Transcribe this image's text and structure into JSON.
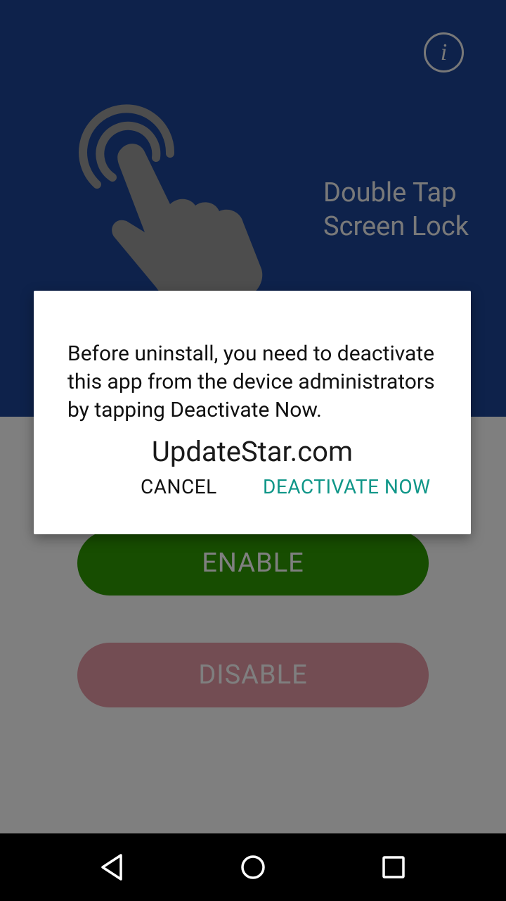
{
  "header": {
    "app_title_line1": "Double Tap",
    "app_title_line2": "Screen Lock",
    "info_icon": "info-icon",
    "hero_icon": "double-tap-hand-icon"
  },
  "buttons": {
    "enable_label": "ENABLE",
    "disable_label": "DISABLE"
  },
  "dialog": {
    "message": "Before uninstall, you need to deactivate this app from the device administrators by tapping Deactivate Now.",
    "cancel_label": "CANCEL",
    "deactivate_label": "DEACTIVATE NOW"
  },
  "watermark": "UpdateStar.com",
  "navbar": {
    "back_icon": "back-triangle-icon",
    "home_icon": "home-circle-icon",
    "recent_icon": "recent-apps-square-icon"
  },
  "colors": {
    "header_bg": "#1c4596",
    "enable_bg": "#2e9a02",
    "disable_bg": "#e79aa7",
    "dialog_accent": "#0f9688"
  }
}
